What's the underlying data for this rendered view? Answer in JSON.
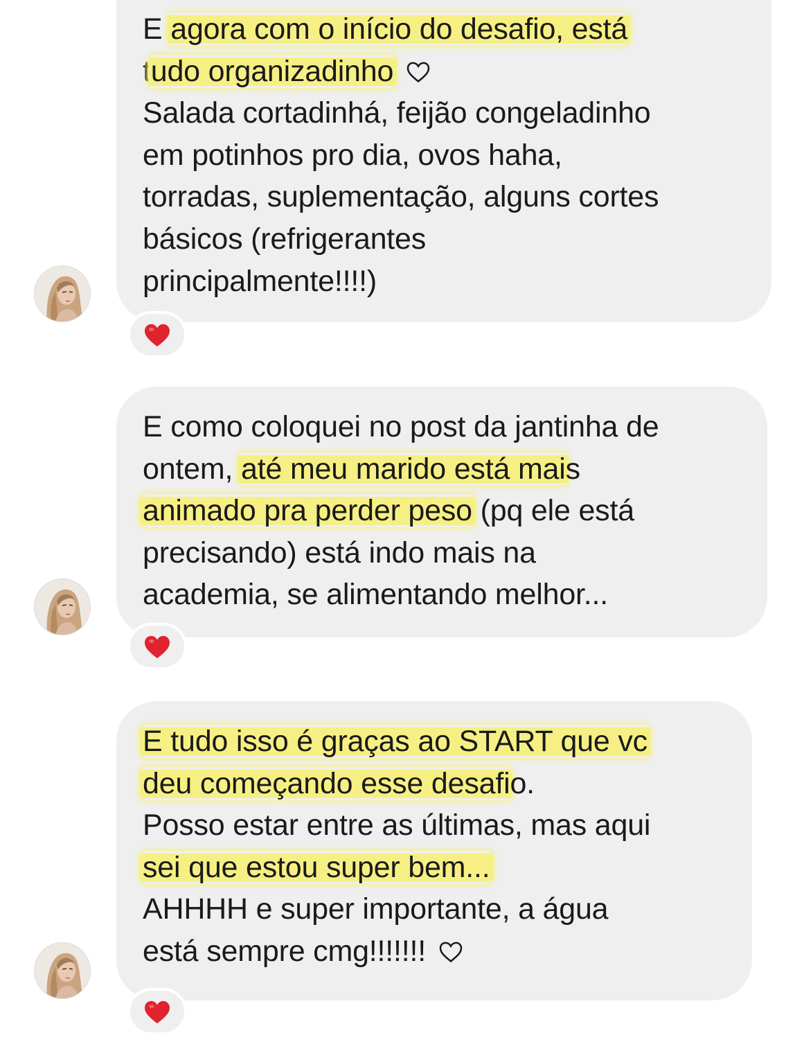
{
  "messages": [
    {
      "lines": [
        [
          "E ",
          {
            "hl": "agora com o início do desafio, está"
          }
        ],
        [
          "t",
          {
            "hl": "udo organizadinho"
          },
          " ",
          {
            "icon": "heart-outline"
          }
        ],
        [
          "Salada cortadinhá, feijão congeladinho"
        ],
        [
          "em potinhos pro dia, ovos haha,"
        ],
        [
          "torradas, suplementação, alguns cortes"
        ],
        [
          "básicos (refrigerantes"
        ],
        [
          "principalmente!!!!)"
        ]
      ],
      "reaction": "❤️"
    },
    {
      "lines": [
        [
          "E como coloquei no post da jantinha de"
        ],
        [
          "ontem, ",
          {
            "hl": "até meu marido está mai"
          },
          "s"
        ],
        [
          {
            "hl": "animado pra perder peso"
          },
          " (pq ele está"
        ],
        [
          "precisando) está indo mais na"
        ],
        [
          "academia, se alimentando melhor..."
        ]
      ],
      "reaction": "❤️"
    },
    {
      "lines": [
        [
          {
            "hl": "E tudo isso é graças ao START que vc"
          }
        ],
        [
          {
            "hl": "deu começando esse desafi"
          },
          "o."
        ],
        [
          "Posso estar entre as últimas, mas aqui"
        ],
        [
          {
            "hl": "sei que estou super bem..."
          }
        ],
        [
          "AHHHH e super importante, a água"
        ],
        [
          "está sempre cmg!!!!!!! ",
          {
            "icon": "heart-outline"
          }
        ]
      ],
      "reaction": "❤️"
    }
  ],
  "colors": {
    "bubble": "#efefef",
    "highlight": "#f6f084",
    "heart": "#e0232f",
    "text": "#1a1a1a"
  }
}
